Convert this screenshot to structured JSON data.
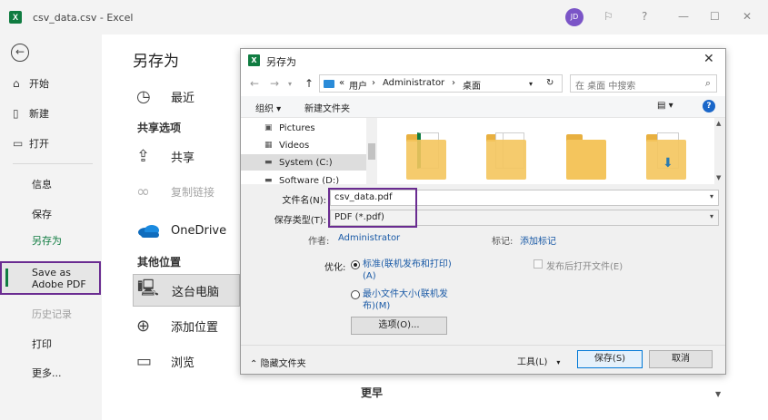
{
  "window": {
    "app_logo": "X",
    "title": "csv_data.csv  -  Excel",
    "avatar_initials": "JD",
    "help": "?",
    "minimize": "—",
    "maximize": "☐",
    "close": "✕"
  },
  "backstage": {
    "back": "←",
    "nav": {
      "home": "开始",
      "new": "新建",
      "open": "打开",
      "info": "信息",
      "save": "保存",
      "save_as": "另存为",
      "save_as_pdf_line1": "Save as",
      "save_as_pdf_line2": "Adobe PDF",
      "history": "历史记录",
      "print": "打印",
      "more": "更多..."
    },
    "title": "另存为",
    "recent": "最近",
    "shared_header": "共享选项",
    "share": "共享",
    "copy_link": "复制链接",
    "onedrive": "OneDrive",
    "other_header": "其他位置",
    "this_pc": "这台电脑",
    "add_place": "添加位置",
    "browse": "浏览",
    "older": "更早"
  },
  "dialog": {
    "logo": "X",
    "title": "另存为",
    "close": "✕",
    "path": {
      "prefix": "«",
      "seg1": "用户",
      "seg2": "Administrator",
      "seg3": "桌面",
      "sep": "›"
    },
    "search_placeholder": "在 桌面 中搜索",
    "toolbar": {
      "organize": "组织 ▾",
      "new_folder": "新建文件夹"
    },
    "tree": [
      "Pictures",
      "Videos",
      "System (C:)",
      "Software (D:)"
    ],
    "file_name_label": "文件名(N):",
    "file_name": "csv_data.pdf",
    "save_type_label": "保存类型(T):",
    "save_type": "PDF (*.pdf)",
    "author_label": "作者:",
    "author": "Administrator",
    "tags_label": "标记:",
    "tags_link": "添加标记",
    "optimize_label": "优化:",
    "opt1_line1": "标准(联机发布和打印)",
    "opt1_line2": "(A)",
    "opt2_line1": "最小文件大小(联机发",
    "opt2_line2": "布)(M)",
    "open_after": "发布后打开文件(E)",
    "options_button": "选项(O)...",
    "hide_folders": "隐藏文件夹",
    "tools": "工具(L)",
    "save_button": "保存(S)",
    "cancel_button": "取消"
  },
  "colors": {
    "excel_green": "#107c41",
    "highlight_purple": "#6a2c91",
    "link_blue": "#1a5aa6"
  }
}
